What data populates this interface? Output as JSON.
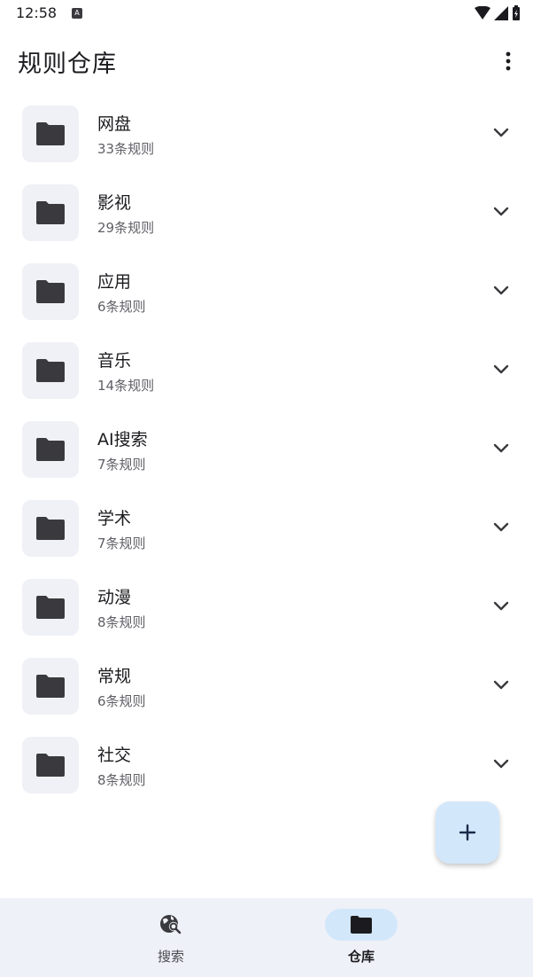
{
  "status_bar": {
    "time": "12:58",
    "badge": "A"
  },
  "app_bar": {
    "title": "规则仓库",
    "more_icon": "more-vert-icon"
  },
  "repos": [
    {
      "name": "网盘",
      "count": "33条规则"
    },
    {
      "name": "影视",
      "count": "29条规则"
    },
    {
      "name": "应用",
      "count": "6条规则"
    },
    {
      "name": "音乐",
      "count": "14条规则"
    },
    {
      "name": "AI搜索",
      "count": "7条规则"
    },
    {
      "name": "学术",
      "count": "7条规则"
    },
    {
      "name": "动漫",
      "count": "8条规则"
    },
    {
      "name": "常规",
      "count": "6条规则"
    },
    {
      "name": "社交",
      "count": "8条规则"
    }
  ],
  "fab": {
    "icon": "plus-icon"
  },
  "bottom_nav": {
    "items": [
      {
        "label": "搜索",
        "icon": "search-globe-icon",
        "active": false
      },
      {
        "label": "仓库",
        "icon": "folder-icon",
        "active": true
      }
    ]
  },
  "colors": {
    "accent_container": "#d3e7fb",
    "surface_variant": "#eff1f6",
    "nav_background": "#eef1f7"
  }
}
